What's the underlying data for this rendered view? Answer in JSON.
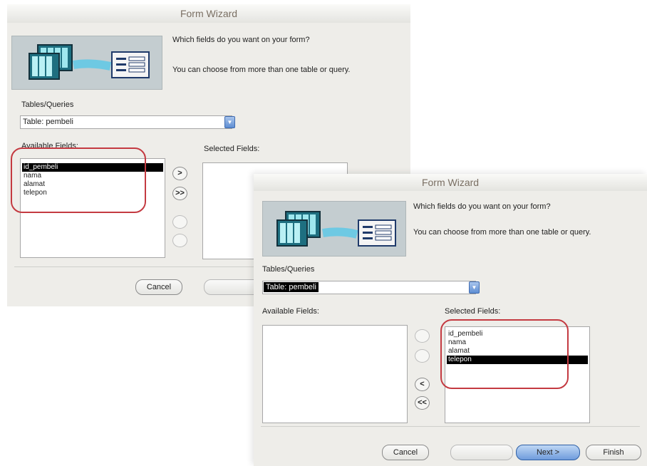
{
  "dialogs": [
    {
      "title": "Form Wizard",
      "prompt_line1": "Which fields do you want on your form?",
      "prompt_line2": "You can choose from more than one table or query.",
      "tables_label": "Tables/Queries",
      "table_value": "Table: pembeli",
      "available_label": "Available Fields:",
      "selected_label": "Selected Fields:",
      "available_fields": [
        "id_pembeli",
        "nama",
        "alamat",
        "telepon"
      ],
      "available_selected": "id_pembeli",
      "selected_fields": [],
      "move_buttons": [
        ">",
        ">>",
        "",
        ""
      ],
      "buttons": {
        "cancel": "Cancel",
        "back": "",
        "next": "",
        "finish": ""
      }
    },
    {
      "title": "Form Wizard",
      "prompt_line1": "Which fields do you want on your form?",
      "prompt_line2": "You can choose from more than one table or query.",
      "tables_label": "Tables/Queries",
      "table_value": "Table: pembeli",
      "available_label": "Available Fields:",
      "selected_label": "Selected Fields:",
      "available_fields": [],
      "selected_fields": [
        "id_pembeli",
        "nama",
        "alamat",
        "telepon"
      ],
      "selected_selected": "telepon",
      "move_buttons": [
        "",
        "",
        "<",
        "<<"
      ],
      "buttons": {
        "cancel": "Cancel",
        "back": "",
        "next": "Next >",
        "finish": "Finish"
      }
    }
  ],
  "colors": {
    "highlight_circle": "#c43a41",
    "dialog_bg": "#eeede9",
    "title_text": "#7a6f63",
    "primary_button": "#6f9bdc"
  },
  "icons": {
    "illustration": "form-wizard-illustration",
    "dropdown": "dropdown-arrow-icon"
  }
}
